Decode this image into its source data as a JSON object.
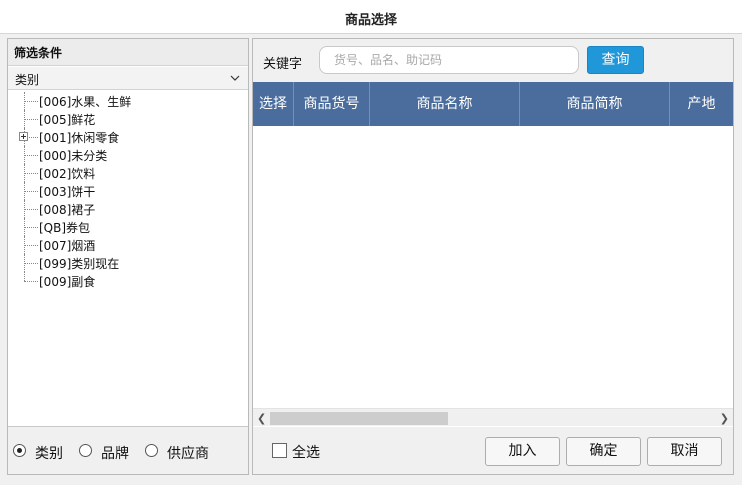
{
  "window": {
    "title": "商品选择"
  },
  "filter": {
    "header": "筛选条件",
    "category_label": "类别",
    "tree": [
      {
        "label": "[006]水果、生鲜",
        "expandable": false
      },
      {
        "label": "[005]鲜花",
        "expandable": false
      },
      {
        "label": "[001]休闲零食",
        "expandable": true
      },
      {
        "label": "[000]未分类",
        "expandable": false
      },
      {
        "label": "[002]饮料",
        "expandable": false
      },
      {
        "label": "[003]饼干",
        "expandable": false
      },
      {
        "label": "[008]裙子",
        "expandable": false
      },
      {
        "label": "[QB]券包",
        "expandable": false
      },
      {
        "label": "[007]烟酒",
        "expandable": false
      },
      {
        "label": "[099]类别现在",
        "expandable": false
      },
      {
        "label": "[009]副食",
        "expandable": false
      }
    ],
    "radios": [
      {
        "label": "类别",
        "selected": true
      },
      {
        "label": "品牌",
        "selected": false
      },
      {
        "label": "供应商",
        "selected": false
      }
    ]
  },
  "search": {
    "keyword_label": "关键字",
    "placeholder": "货号、品名、助记码",
    "value": "",
    "query_label": "查询"
  },
  "grid": {
    "columns": [
      "选择",
      "商品货号",
      "商品名称",
      "商品简称",
      "产地"
    ],
    "rows": []
  },
  "footer": {
    "select_all_label": "全选",
    "add_label": "加入",
    "confirm_label": "确定",
    "cancel_label": "取消"
  },
  "colors": {
    "header_bg": "#4a6d9d",
    "query_button": "#1f97d9"
  }
}
